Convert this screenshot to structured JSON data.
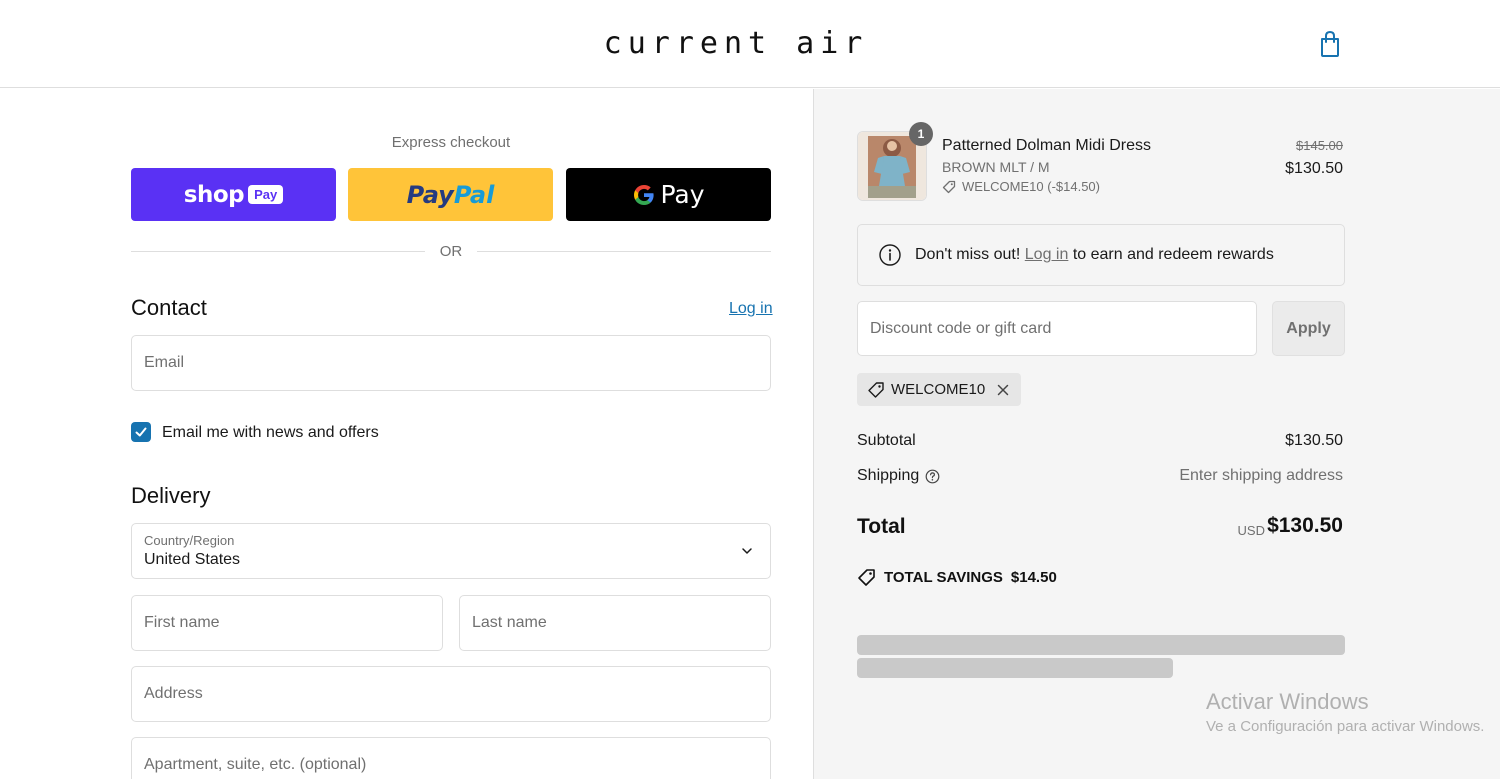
{
  "header": {
    "logo": "current air",
    "bag_icon": "shopping-bag-icon"
  },
  "express": {
    "title": "Express checkout",
    "shop_pay": {
      "word": "shop",
      "tag": "Pay"
    },
    "paypal": {
      "part1": "Pay",
      "part2": "Pal"
    },
    "gpay": {
      "word": "Pay"
    },
    "or": "OR"
  },
  "contact": {
    "title": "Contact",
    "login": "Log in",
    "email_placeholder": "Email",
    "newsletter_label": "Email me with news and offers",
    "newsletter_checked": true
  },
  "delivery": {
    "title": "Delivery",
    "country_label": "Country/Region",
    "country_value": "United States",
    "first_name_placeholder": "First name",
    "last_name_placeholder": "Last name",
    "address_placeholder": "Address",
    "apartment_placeholder": "Apartment, suite, etc. (optional)"
  },
  "summary": {
    "item": {
      "quantity": "1",
      "name": "Patterned Dolman Midi Dress",
      "variant": "BROWN MLT / M",
      "discount": "WELCOME10 (-$14.50)",
      "price_original": "$145.00",
      "price_final": "$130.50"
    },
    "rewards": {
      "prefix": "Don't miss out!",
      "link": "Log in",
      "suffix": "to earn and redeem rewards"
    },
    "discount_placeholder": "Discount code or gift card",
    "apply_label": "Apply",
    "applied_code": "WELCOME10",
    "subtotal_label": "Subtotal",
    "subtotal_value": "$130.50",
    "shipping_label": "Shipping",
    "shipping_value": "Enter shipping address",
    "total_label": "Total",
    "total_currency": "USD",
    "total_value": "$130.50",
    "savings_label": "TOTAL SAVINGS",
    "savings_value": "$14.50"
  },
  "watermark": {
    "title": "Activar Windows",
    "subtitle": "Ve a Configuración para activar Windows."
  },
  "colors": {
    "accent": "#1773b0",
    "shop_pay": "#5a31f4",
    "paypal": "#ffc439",
    "gpay": "#000000",
    "summary_bg": "#f5f5f5"
  }
}
